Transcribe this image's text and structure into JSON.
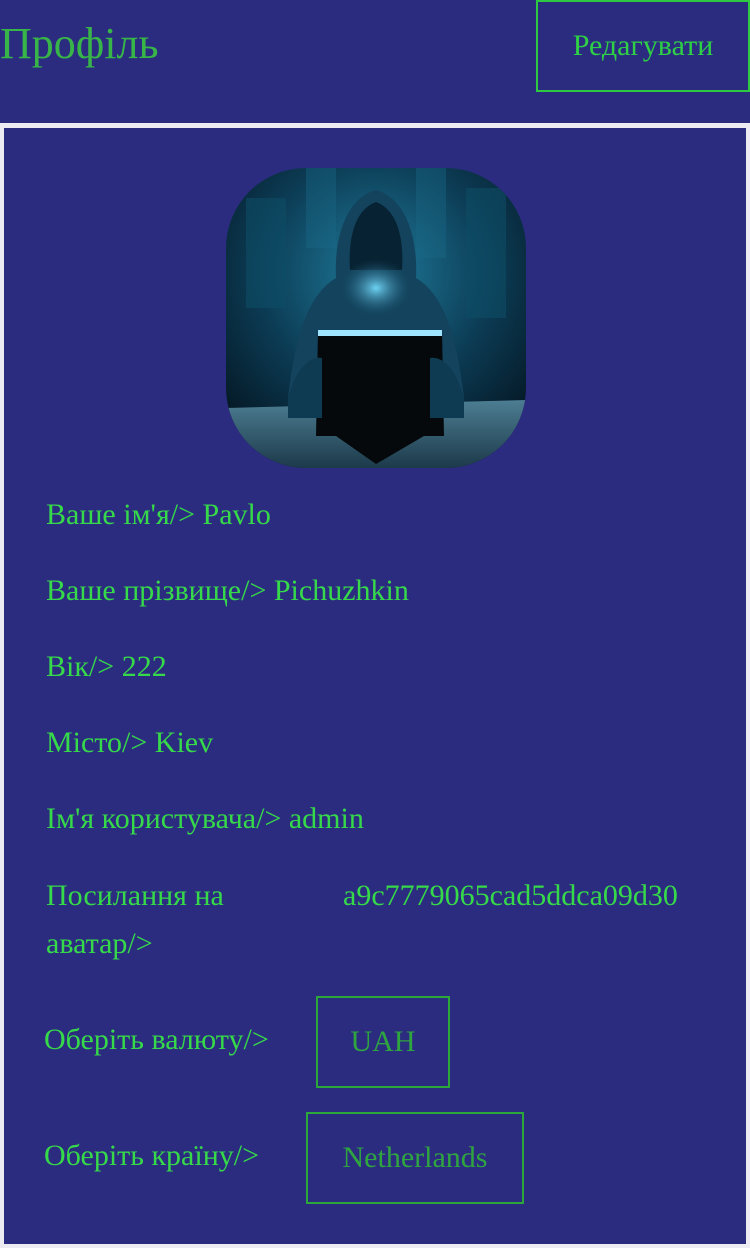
{
  "header": {
    "title": "Профіль",
    "edit_label": "Редагувати"
  },
  "colors": {
    "background": "#2b2c80",
    "accent": "#36d949",
    "border": "#2ec842",
    "page": "#ececf2"
  },
  "profile": {
    "avatar_icon": "hooded-hacker-avatar",
    "first_name": {
      "label": "Ваше ім'я/>",
      "value": "Pavlo"
    },
    "last_name": {
      "label": "Ваше прізвище/>",
      "value": "Pichuzhkin"
    },
    "age": {
      "label": "Вік/>",
      "value": "222"
    },
    "city": {
      "label": "Місто/>",
      "value": "Kiev"
    },
    "username": {
      "label": "Ім'я користувача/>",
      "value": "admin"
    },
    "avatar_link": {
      "label": "Посилання на аватар/>",
      "value": "a9c7779065cad5ddca09d30"
    },
    "currency": {
      "label": "Оберіть валюту/>",
      "value": "UAH"
    },
    "country": {
      "label": "Оберіть країну/>",
      "value": "Netherlands"
    }
  }
}
